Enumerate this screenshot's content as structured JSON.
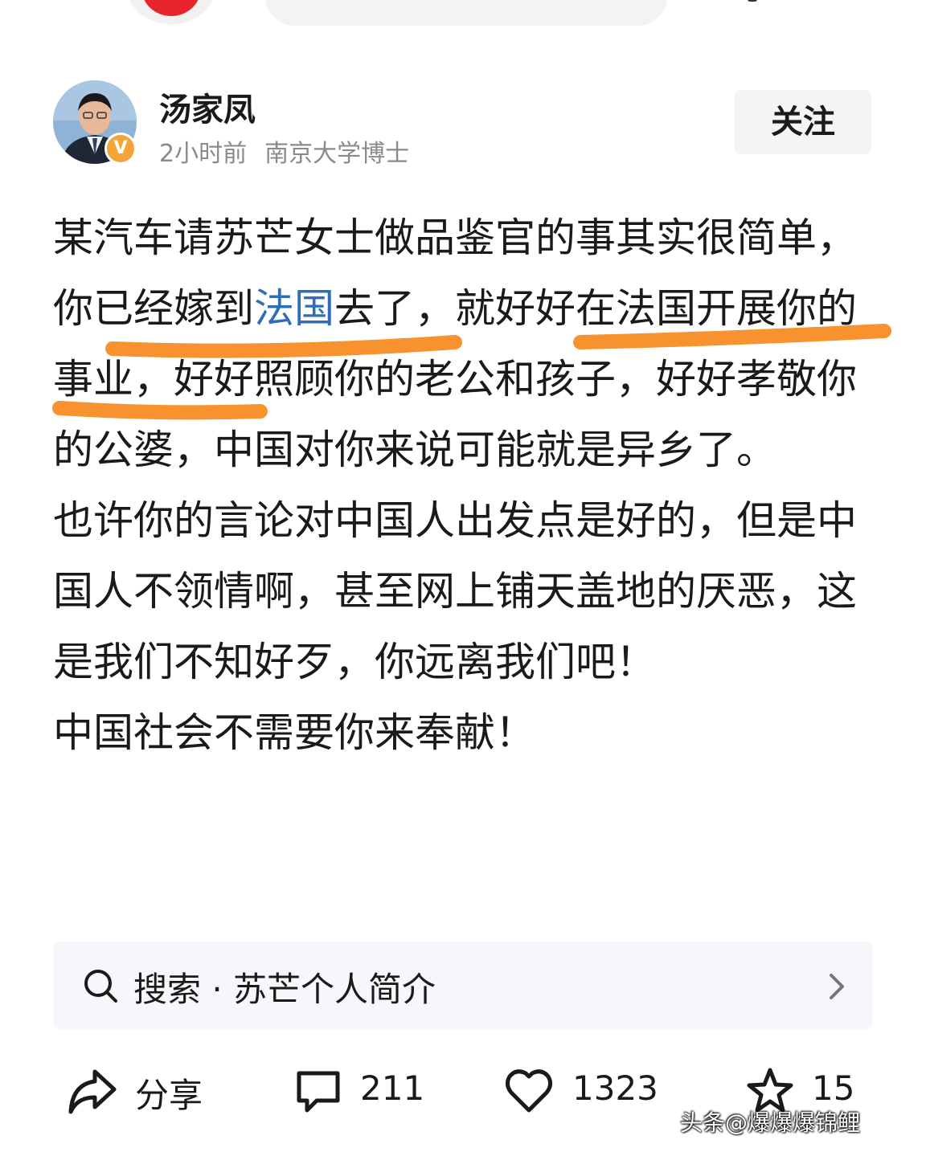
{
  "author": {
    "name": "汤家凤",
    "time": "2小时前",
    "title": "南京大学博士",
    "verified_mark": "V"
  },
  "follow_label": "关注",
  "post": {
    "p1_a": "某汽车请苏芒女士做品鉴官的事其实很简单，你已经嫁到",
    "p1_link": "法国",
    "p1_b": "去了，就好好在法国开展你的事业，好好照顾你的老公和孩子，好好孝敬你的公婆，中国对你来说可能就是异乡了。",
    "p2": "也许你的言论对中国人出发点是好的，但是中国人不领情啊，甚至网上铺天盖地的厌恶，这是我们不知好歹，你远离我们吧！",
    "p3": "中国社会不需要你来奉献！"
  },
  "search_suggestion": "搜索 · 苏芒个人简介",
  "actions": {
    "share": "分享",
    "comments": "211",
    "likes": "1323",
    "favorites": "15"
  },
  "watermark": "头条@爆爆爆锦鲤",
  "colors": {
    "link": "#2f6db6",
    "highlight": "#f7922e",
    "badge": "#f3a53a"
  }
}
